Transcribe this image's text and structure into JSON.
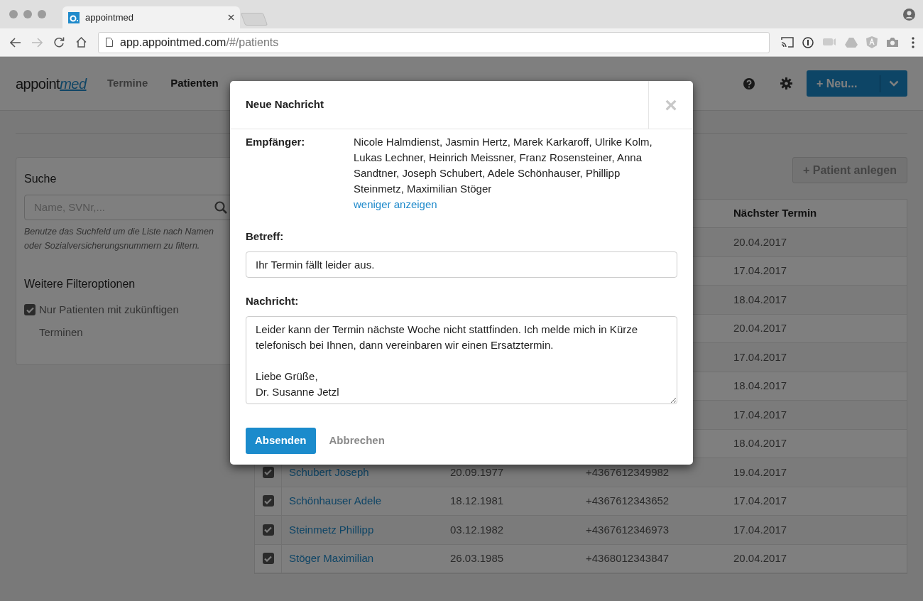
{
  "browser": {
    "tab_title": "appointmed",
    "url": {
      "host": "app.appointmed.com",
      "path": "/#/patients"
    }
  },
  "app": {
    "logo": {
      "first": "appoint",
      "second": "med"
    },
    "nav": [
      {
        "label": "Termine",
        "selected": false
      },
      {
        "label": "Patienten",
        "selected": true
      }
    ],
    "new_button": "+ Neu...",
    "sidebar": {
      "search_title": "Suche",
      "search_placeholder": "Name, SVNr,...",
      "search_help": "Benutze das Suchfeld um die Liste nach Namen oder Sozialversicherungsnummern zu filtern.",
      "filter_title": "Weitere Filteroptionen",
      "filter": {
        "label": "Nur Patienten mit zukünftigen Terminen",
        "checked": true
      }
    },
    "add_patient_button": "+ Patient anlegen",
    "table": {
      "columns": [
        {
          "label": "Nächster Termin"
        }
      ],
      "rows": [
        {
          "next": "20.04.2017"
        },
        {
          "next": "17.04.2017"
        },
        {
          "next": "18.04.2017"
        },
        {
          "next": "20.04.2017"
        },
        {
          "next": "17.04.2017"
        },
        {
          "next": "18.04.2017"
        },
        {
          "next": "17.04.2017"
        },
        {
          "next": "18.04.2017"
        },
        {
          "checked": true,
          "name": "Schubert Joseph",
          "birth": "20.09.1977",
          "phone": "+4367612349982",
          "next": "19.04.2017"
        },
        {
          "checked": true,
          "name": "Schönhauser Adele",
          "birth": "18.12.1981",
          "phone": "+4367612343652",
          "next": "17.04.2017"
        },
        {
          "checked": true,
          "name": "Steinmetz Phillipp",
          "birth": "03.12.1982",
          "phone": "+4367612346973",
          "next": "17.04.2017"
        },
        {
          "checked": true,
          "name": "Stöger Maximilian",
          "birth": "26.03.1985",
          "phone": "+4368012343847",
          "next": "20.04.2017"
        }
      ]
    }
  },
  "dialog": {
    "title": "Neue Nachricht",
    "close": "×",
    "recipients_label": "Empfänger:",
    "recipients": "Nicole Halmdienst, Jasmin Hertz, Marek Karkaroff, Ulrike Kolm, Lukas Lechner, Heinrich Meissner, Franz Rosensteiner, Anna Sandtner, Joseph Schubert, Adele Schönhauser, Phillipp Steinmetz, Maximilian Stöger",
    "show_less": "weniger anzeigen",
    "subject_label": "Betreff:",
    "subject": "Ihr Termin fällt leider aus.",
    "message_label": "Nachricht:",
    "message": "Leider kann der Termin nächste Woche nicht stattfinden. Ich melde mich in Kürze telefonisch bei Ihnen, dann vereinbaren wir einen Ersatztermin.\n\nLiebe Grüße,\nDr. Susanne Jetzl",
    "send": "Absenden",
    "cancel": "Abbrechen"
  }
}
